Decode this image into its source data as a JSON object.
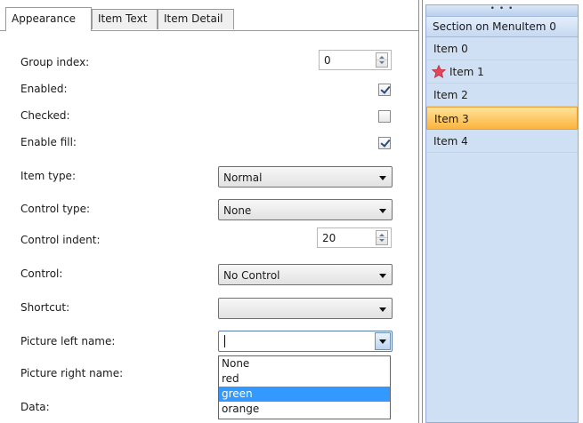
{
  "tabs": [
    {
      "label": "Appearance",
      "active": true
    },
    {
      "label": "Item Text",
      "active": false
    },
    {
      "label": "Item Detail",
      "active": false
    }
  ],
  "properties": {
    "group_index": {
      "label": "Group index:",
      "value": "0"
    },
    "enabled": {
      "label": "Enabled:",
      "checked": true
    },
    "checked": {
      "label": "Checked:",
      "checked": false
    },
    "enable_fill": {
      "label": "Enable fill:",
      "checked": true
    },
    "item_type": {
      "label": "Item type:",
      "value": "Normal"
    },
    "control_type": {
      "label": "Control type:",
      "value": "None"
    },
    "control_indent": {
      "label": "Control indent:",
      "value": "20"
    },
    "control": {
      "label": "Control:",
      "value": "No Control"
    },
    "shortcut": {
      "label": "Shortcut:",
      "value": ""
    },
    "picture_left_name": {
      "label": "Picture left name:",
      "value": ""
    },
    "picture_right_name": {
      "label": "Picture right name:"
    },
    "data": {
      "label": "Data:"
    }
  },
  "dropdown": {
    "options": [
      "None",
      "red",
      "green",
      "orange"
    ],
    "selected": "green"
  },
  "menu": {
    "grip": "• • •",
    "section": "Section on MenuItem 0",
    "items": [
      {
        "label": "Item 0",
        "icon": null,
        "highlighted": false
      },
      {
        "label": "Item 1",
        "icon": "star-icon",
        "highlighted": false
      },
      {
        "label": "Item 2",
        "icon": null,
        "highlighted": false
      },
      {
        "label": "Item 3",
        "icon": null,
        "highlighted": true
      },
      {
        "label": "Item 4",
        "icon": null,
        "highlighted": false
      }
    ]
  },
  "colors": {
    "menu_background": "#cfe0f4",
    "highlight": "#fbb43e",
    "dropdown_selection": "#3399ff",
    "star": "#e0475a"
  }
}
